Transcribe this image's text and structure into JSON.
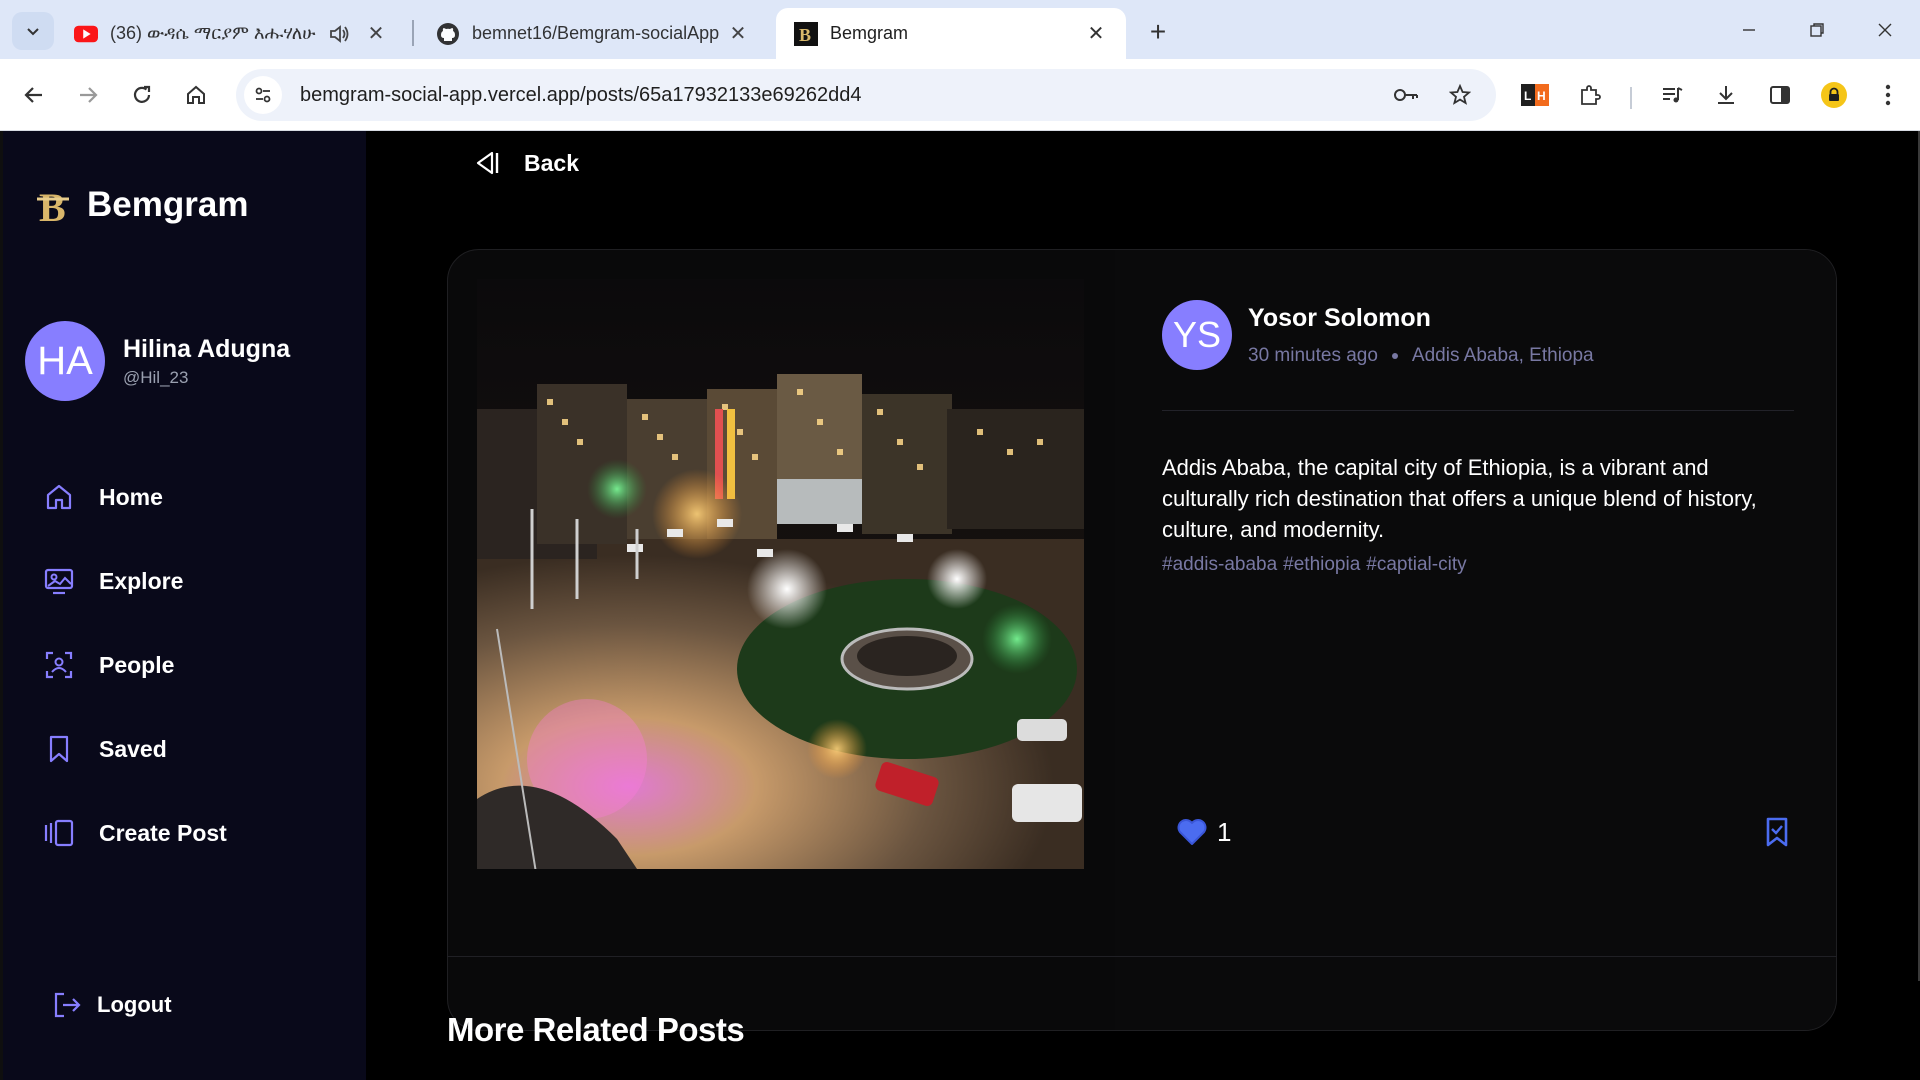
{
  "browser": {
    "tabs": [
      {
        "title": "(36) ውዳሴ ማርያም እሑሃለሁ",
        "icon": "youtube-icon",
        "audio": true
      },
      {
        "title": "bemnet16/Bemgram-socialApp",
        "icon": "github-icon"
      },
      {
        "title": "Bemgram",
        "icon": "bemgram-favicon",
        "active": true
      }
    ],
    "url": "bemgram-social-app.vercel.app/posts/65a17932133e69262dd4"
  },
  "app": {
    "brand": "Bemgram",
    "user": {
      "initials": "HA",
      "name": "Hilina Adugna",
      "handle": "@Hil_23"
    },
    "nav": [
      {
        "label": "Home",
        "icon": "home-icon"
      },
      {
        "label": "Explore",
        "icon": "explore-icon"
      },
      {
        "label": "People",
        "icon": "people-icon"
      },
      {
        "label": "Saved",
        "icon": "bookmark-icon"
      },
      {
        "label": "Create Post",
        "icon": "create-post-icon"
      }
    ],
    "logout_label": "Logout",
    "back_label": "Back",
    "post": {
      "author_initials": "YS",
      "author": "Yosor Solomon",
      "time": "30 minutes ago",
      "location": "Addis Ababa, Ethiopa",
      "caption": "Addis Ababa, the capital city of Ethiopia, is a vibrant and culturally rich destination that offers a unique blend of history, culture, and modernity.",
      "tags": [
        "#addis-ababa",
        "#ethiopia",
        "#captial-city"
      ],
      "likes": "1"
    },
    "related_title": "More Related Posts",
    "colors": {
      "accent": "#877eff",
      "muted": "#7878a3",
      "sidebar_bg": "#09091a"
    }
  }
}
